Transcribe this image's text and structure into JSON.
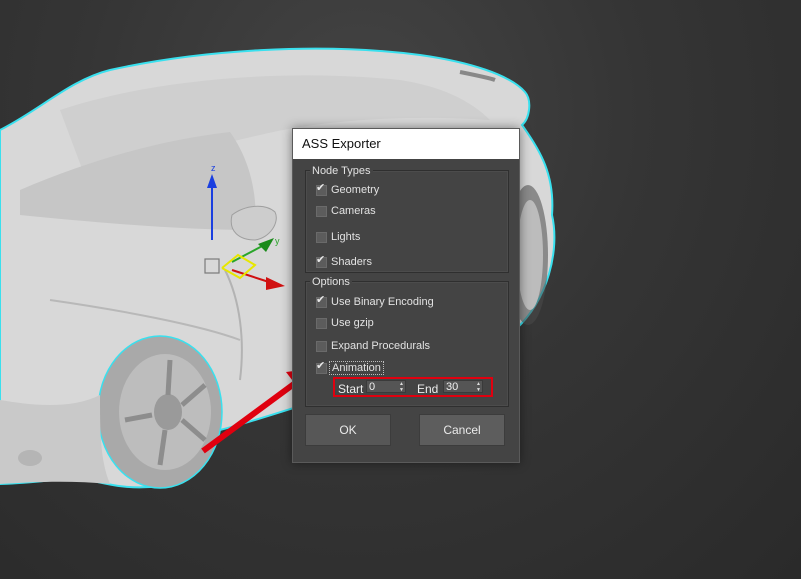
{
  "dialog": {
    "title": "ASS Exporter",
    "node_types": {
      "title": "Node Types",
      "items": [
        {
          "label": "Geometry",
          "checked": true
        },
        {
          "label": "Cameras",
          "checked": false
        },
        {
          "label": "Lights",
          "checked": false
        },
        {
          "label": "Shaders",
          "checked": true
        }
      ]
    },
    "options": {
      "title": "Options",
      "items": [
        {
          "label": "Use Binary Encoding",
          "checked": true
        },
        {
          "label": "Use gzip",
          "checked": false
        },
        {
          "label": "Expand Procedurals",
          "checked": false
        },
        {
          "label": "Animation",
          "checked": true
        }
      ],
      "start_label": "Start",
      "start_value": "0",
      "end_label": "End",
      "end_value": "30"
    },
    "ok_label": "OK",
    "cancel_label": "Cancel"
  },
  "gizmo": {
    "z_label": "z",
    "y_label": "y"
  },
  "colors": {
    "selection_outline": "#39e0ee",
    "annotation_red": "#e0000f",
    "dialog_bg": "#444444"
  }
}
